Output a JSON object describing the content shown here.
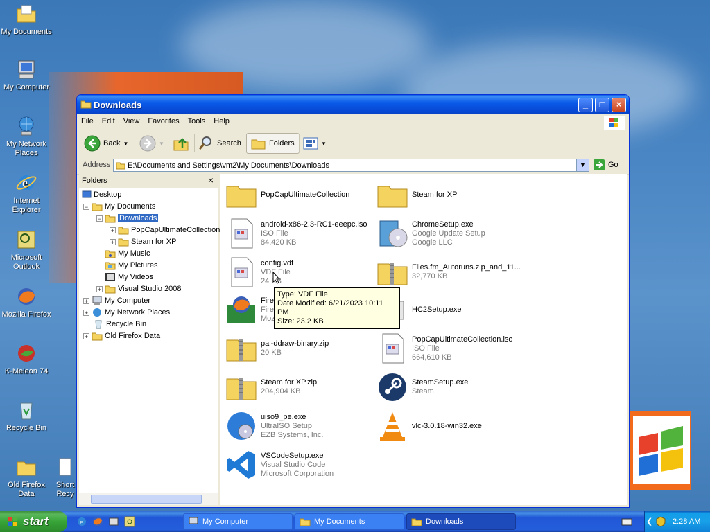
{
  "desktop": {
    "icons": [
      {
        "label": "My Documents",
        "icon": "documents-folder-icon"
      },
      {
        "label": "My Computer",
        "icon": "computer-icon"
      },
      {
        "label": "My Network Places",
        "icon": "network-icon"
      },
      {
        "label": "Internet Explorer",
        "icon": "ie-icon"
      },
      {
        "label": "Microsoft Outlook",
        "icon": "outlook-icon"
      },
      {
        "label": "Mozilla Firefox",
        "icon": "firefox-icon"
      },
      {
        "label": "K-Meleon 74",
        "icon": "kmeleon-icon"
      },
      {
        "label": "Recycle Bin",
        "icon": "recycle-bin-icon"
      },
      {
        "label": "Old Firefox Data",
        "icon": "folder-icon"
      },
      {
        "label": "Short Recy",
        "icon": "shortcut-icon"
      }
    ]
  },
  "window": {
    "title": "Downloads",
    "menu": [
      "File",
      "Edit",
      "View",
      "Favorites",
      "Tools",
      "Help"
    ],
    "toolbar": {
      "back": "Back",
      "search": "Search",
      "folders": "Folders"
    },
    "address": {
      "label": "Address",
      "value": "E:\\Documents and Settings\\vm2\\My Documents\\Downloads",
      "go": "Go"
    },
    "folders_pane": {
      "title": "Folders",
      "tree": [
        {
          "label": "Desktop",
          "indent": 0,
          "exp": "",
          "icon": "desktop-icon"
        },
        {
          "label": "My Documents",
          "indent": 1,
          "exp": "-",
          "icon": "documents-folder-icon"
        },
        {
          "label": "Downloads",
          "indent": 2,
          "exp": "-",
          "icon": "folder-icon",
          "selected": true
        },
        {
          "label": "PopCapUltimateCollection",
          "indent": 3,
          "exp": "+",
          "icon": "folder-icon"
        },
        {
          "label": "Steam for XP",
          "indent": 3,
          "exp": "+",
          "icon": "folder-icon"
        },
        {
          "label": "My Music",
          "indent": 2,
          "exp": "",
          "icon": "music-folder-icon"
        },
        {
          "label": "My Pictures",
          "indent": 2,
          "exp": "",
          "icon": "pictures-folder-icon"
        },
        {
          "label": "My Videos",
          "indent": 2,
          "exp": "",
          "icon": "videos-folder-icon"
        },
        {
          "label": "Visual Studio 2008",
          "indent": 2,
          "exp": "+",
          "icon": "folder-icon"
        },
        {
          "label": "My Computer",
          "indent": 1,
          "exp": "+",
          "icon": "computer-icon"
        },
        {
          "label": "My Network Places",
          "indent": 1,
          "exp": "+",
          "icon": "network-icon"
        },
        {
          "label": "Recycle Bin",
          "indent": 1,
          "exp": "",
          "icon": "recycle-bin-icon"
        },
        {
          "label": "Old Firefox Data",
          "indent": 1,
          "exp": "+",
          "icon": "folder-icon"
        }
      ]
    },
    "files": [
      {
        "name": "PopCapUltimateCollection",
        "sub1": "",
        "sub2": "",
        "icon": "folder-icon"
      },
      {
        "name": "Steam for XP",
        "sub1": "",
        "sub2": "",
        "icon": "folder-icon"
      },
      {
        "name": "android-x86-2.3-RC1-eeepc.iso",
        "sub1": "ISO File",
        "sub2": "84,420 KB",
        "icon": "iso-file-icon"
      },
      {
        "name": "ChromeSetup.exe",
        "sub1": "Google Update Setup",
        "sub2": "Google LLC",
        "icon": "installer-icon"
      },
      {
        "name": "config.vdf",
        "sub1": "VDF File",
        "sub2": "24 KB",
        "icon": "generic-file-icon"
      },
      {
        "name": "Files.fm_Autoruns.zip_and_11...",
        "sub1": "32,770 KB",
        "sub2": "",
        "icon": "zip-folder-icon"
      },
      {
        "name": "Fire",
        "sub1": "Fire",
        "sub2": "Moz",
        "icon": "firefox-installer-icon"
      },
      {
        "name": "HC2Setup.exe",
        "sub1": "",
        "sub2": "",
        "icon": "generic-exe-icon"
      },
      {
        "name": "pal-ddraw-binary.zip",
        "sub1": "20 KB",
        "sub2": "",
        "icon": "zip-folder-icon"
      },
      {
        "name": "PopCapUltimateCollection.iso",
        "sub1": "ISO File",
        "sub2": "664,610 KB",
        "icon": "iso-file-icon"
      },
      {
        "name": "Steam for XP.zip",
        "sub1": "204,904 KB",
        "sub2": "",
        "icon": "zip-folder-icon"
      },
      {
        "name": "SteamSetup.exe",
        "sub1": "Steam",
        "sub2": "",
        "icon": "steam-icon"
      },
      {
        "name": "uiso9_pe.exe",
        "sub1": "UltraISO Setup",
        "sub2": "EZB Systems, Inc.",
        "icon": "ultraiso-icon"
      },
      {
        "name": "vlc-3.0.18-win32.exe",
        "sub1": "",
        "sub2": "",
        "icon": "vlc-icon"
      },
      {
        "name": "VSCodeSetup.exe",
        "sub1": "Visual Studio Code",
        "sub2": "Microsoft Corporation",
        "icon": "vscode-icon"
      }
    ],
    "tooltip": {
      "type": "Type: VDF File",
      "modified": "Date Modified: 6/21/2023 10:11 PM",
      "size": "Size: 23.2 KB"
    }
  },
  "taskbar": {
    "start": "start",
    "tasks": [
      {
        "label": "My Computer",
        "icon": "computer-icon",
        "active": false
      },
      {
        "label": "My Documents",
        "icon": "documents-folder-icon",
        "active": false
      },
      {
        "label": "Downloads",
        "icon": "folder-icon",
        "active": true
      }
    ],
    "clock": "2:28 AM"
  },
  "colors": {
    "title_blue": "#0a5ae8",
    "selection": "#316ac5",
    "start_green": "#37a437"
  }
}
